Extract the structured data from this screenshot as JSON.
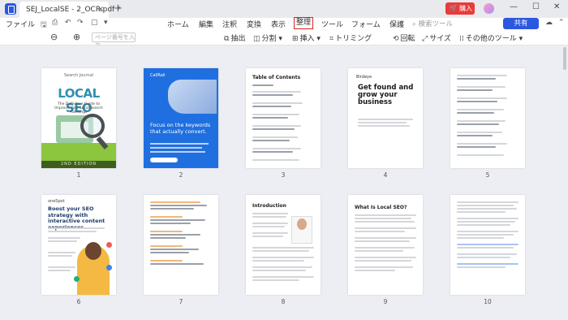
{
  "titlebar": {
    "doc_tab": "SEJ_LocalSE - 2_OCR.pdf *",
    "close": "×",
    "new_tab": "+",
    "buy_label": "購入",
    "minimize": "—",
    "maximize": "☐",
    "close_window": "✕"
  },
  "menubar": {
    "file": "ファイル",
    "items": [
      "ホーム",
      "編集",
      "注釈",
      "変換",
      "表示",
      "整理",
      "ツール",
      "フォーム",
      "保護"
    ],
    "active": "整理",
    "search_placeholder": "検索ツール",
    "share_label": "共有"
  },
  "toolbar": {
    "page_input_placeholder": "ページ番号を入力",
    "extract": "抽出",
    "split": "分割",
    "insert": "挿入",
    "trim": "トリミング",
    "rotate": "回転",
    "size": "サイズ",
    "other_tools": "その他のツール"
  },
  "pages": {
    "p1": {
      "num": "1",
      "subtitle": "Search Journal",
      "title": "LOCAL SEO",
      "tagline": "The Definitive Guide to Improve Your Local Search Rankings",
      "edition": "2ND EDITION"
    },
    "p2": {
      "num": "2",
      "logo": "CallRail",
      "headline": "Focus on the keywords that actually convert."
    },
    "p3": {
      "num": "3",
      "title": "Table of Contents"
    },
    "p4": {
      "num": "4",
      "logo": "Birdeye",
      "title": "Get found and grow your business"
    },
    "p5": {
      "num": "5"
    },
    "p6": {
      "num": "6",
      "logo": "oneSpot",
      "title": "Boost your SEO strategy with interactive content experiences"
    },
    "p7": {
      "num": "7"
    },
    "p8": {
      "num": "8",
      "title": "Introduction"
    },
    "p9": {
      "num": "9",
      "title": "What Is Local SEO?"
    },
    "p10": {
      "num": "10"
    }
  }
}
